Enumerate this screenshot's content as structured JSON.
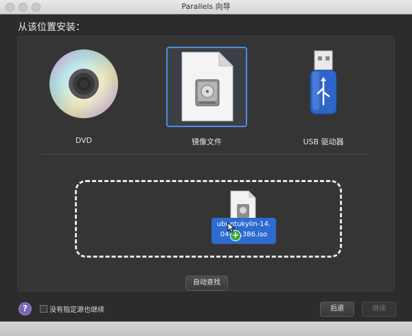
{
  "window": {
    "title": "Parallels 向导"
  },
  "heading": "从该位置安装：",
  "options": [
    {
      "label": "DVD",
      "icon": "dvd-disc-icon",
      "selected": false
    },
    {
      "label": "镜像文件",
      "icon": "image-file-icon",
      "selected": true
    },
    {
      "label": "USB 驱动器",
      "icon": "usb-drive-icon",
      "selected": false
    }
  ],
  "dragged_file": {
    "line1": "ubuntukylin-14.",
    "line2": "04-d...386.iso"
  },
  "auto_find_label": "自动查找",
  "help_label": "?",
  "checkbox": {
    "label": "没有指定源也继续",
    "checked": false
  },
  "buttons": {
    "back": "后退",
    "continue": "继续"
  }
}
